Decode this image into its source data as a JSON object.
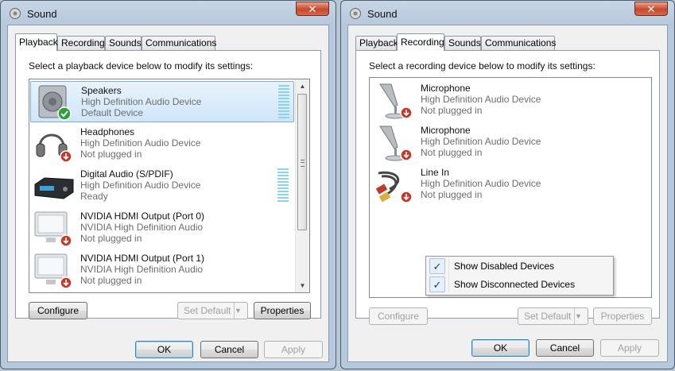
{
  "windows": [
    {
      "title": "Sound",
      "close_label": "✕",
      "tabs": [
        "Playback",
        "Recording",
        "Sounds",
        "Communications"
      ],
      "active_tab": 0,
      "instruction": "Select a playback device below to modify its settings:",
      "devices": [
        {
          "name": "Speakers",
          "line1": "High Definition Audio Device",
          "line2": "Default Device",
          "icon": "speaker-icon",
          "status": "default-check-icon",
          "selected": true,
          "level_meter": true
        },
        {
          "name": "Headphones",
          "line1": "High Definition Audio Device",
          "line2": "Not plugged in",
          "icon": "headphones-icon",
          "status": "unplugged-arrow-icon",
          "selected": false,
          "level_meter": false
        },
        {
          "name": "Digital Audio (S/PDIF)",
          "line1": "High Definition Audio Device",
          "line2": "Ready",
          "icon": "digital-receiver-icon",
          "status": "",
          "selected": false,
          "level_meter": true
        },
        {
          "name": "NVIDIA HDMI Output (Port 0)",
          "line1": "NVIDIA High Definition Audio",
          "line2": "Not plugged in",
          "icon": "monitor-icon",
          "status": "unplugged-arrow-icon",
          "selected": false,
          "level_meter": false
        },
        {
          "name": "NVIDIA HDMI Output (Port 1)",
          "line1": "NVIDIA High Definition Audio",
          "line2": "Not plugged in",
          "icon": "monitor-icon",
          "status": "unplugged-arrow-icon",
          "selected": false,
          "level_meter": false
        }
      ],
      "buttons": {
        "configure": "Configure",
        "set_default": "Set Default",
        "properties": "Properties",
        "ok": "OK",
        "cancel": "Cancel",
        "apply": "Apply"
      },
      "button_state": {
        "configure": "enabled",
        "set_default": "disabled",
        "properties": "enabled",
        "apply": "disabled"
      }
    },
    {
      "title": "Sound",
      "close_label": "✕",
      "tabs": [
        "Playback",
        "Recording",
        "Sounds",
        "Communications"
      ],
      "active_tab": 1,
      "instruction": "Select a recording device below to modify its settings:",
      "devices": [
        {
          "name": "Microphone",
          "line1": "High Definition Audio Device",
          "line2": "Not plugged in",
          "icon": "microphone-icon",
          "status": "unplugged-arrow-icon",
          "selected": false,
          "level_meter": false
        },
        {
          "name": "Microphone",
          "line1": "High Definition Audio Device",
          "line2": "Not plugged in",
          "icon": "microphone-icon",
          "status": "unplugged-arrow-icon",
          "selected": false,
          "level_meter": false
        },
        {
          "name": "Line In",
          "line1": "High Definition Audio Device",
          "line2": "Not plugged in",
          "icon": "rca-cable-icon",
          "status": "unplugged-arrow-icon",
          "selected": false,
          "level_meter": false
        }
      ],
      "context_menu": [
        {
          "label": "Show Disabled Devices",
          "checked": true
        },
        {
          "label": "Show Disconnected Devices",
          "checked": true
        }
      ],
      "buttons": {
        "configure": "Configure",
        "set_default": "Set Default",
        "properties": "Properties",
        "ok": "OK",
        "cancel": "Cancel",
        "apply": "Apply"
      },
      "button_state": {
        "configure": "disabled",
        "set_default": "disabled",
        "properties": "disabled",
        "apply": "disabled"
      }
    }
  ],
  "colors": {
    "selection": "#cfe6fa",
    "status_red": "#c0392b",
    "status_green": "#2e9e3b",
    "meter": "#8fd3e8"
  }
}
